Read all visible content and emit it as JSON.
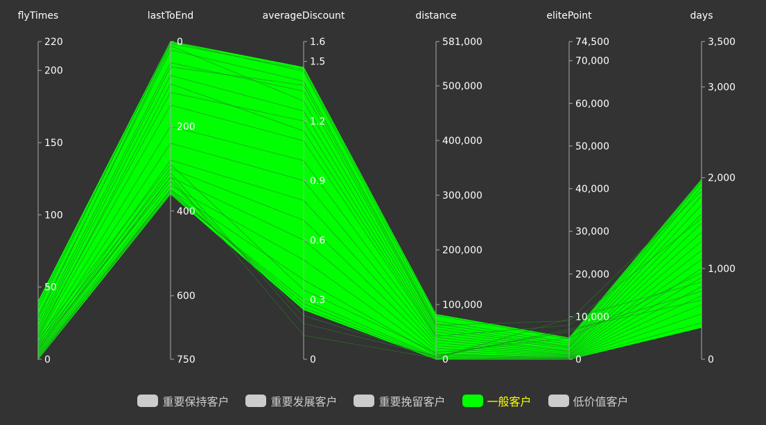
{
  "chart_data": {
    "type": "parallel",
    "dimensions": [
      {
        "name": "flyTimes",
        "min": 0,
        "max": 220,
        "ticks": [
          0,
          50,
          100,
          150,
          200,
          220
        ],
        "tick_labels": [
          "0",
          "50",
          "100",
          "150",
          "200",
          "220"
        ],
        "inverse": false
      },
      {
        "name": "lastToEnd",
        "min": 0,
        "max": 750,
        "ticks": [
          0,
          200,
          400,
          600,
          750
        ],
        "tick_labels": [
          "0",
          "200",
          "400",
          "600",
          "750"
        ],
        "inverse": true
      },
      {
        "name": "averageDiscount",
        "min": 0,
        "max": 1.6,
        "ticks": [
          0,
          0.3,
          0.6,
          0.9,
          1.2,
          1.5,
          1.6
        ],
        "tick_labels": [
          "0",
          "0.3",
          "0.6",
          "0.9",
          "1.2",
          "1.5",
          "1.6"
        ],
        "inverse": false
      },
      {
        "name": "distance",
        "min": 0,
        "max": 581000,
        "ticks": [
          0,
          100000,
          200000,
          300000,
          400000,
          500000,
          581000
        ],
        "tick_labels": [
          "0",
          "100,000",
          "200,000",
          "300,000",
          "400,000",
          "500,000",
          "581,000"
        ],
        "inverse": false
      },
      {
        "name": "elitePoint",
        "min": 0,
        "max": 74500,
        "ticks": [
          0,
          10000,
          20000,
          30000,
          40000,
          50000,
          60000,
          70000,
          74500
        ],
        "tick_labels": [
          "0",
          "10,000",
          "20,000",
          "30,000",
          "40,000",
          "50,000",
          "60,000",
          "70,000",
          "74,500"
        ],
        "inverse": false
      },
      {
        "name": "days",
        "min": 0,
        "max": 3500,
        "ticks": [
          0,
          1000,
          2000,
          3000,
          3500
        ],
        "tick_labels": [
          "0",
          "1,000",
          "2,000",
          "3,000",
          "3,500"
        ],
        "inverse": false
      }
    ],
    "visible_series": "一般客户",
    "series_envelope": {
      "upper": [
        40,
        0,
        1.47,
        82000,
        5000,
        1980
      ],
      "lower": [
        0,
        360,
        0.25,
        0,
        0,
        350
      ]
    },
    "series_lines": [
      [
        35,
        0,
        1.45,
        70000,
        4000,
        1950
      ],
      [
        30,
        20,
        1.4,
        65000,
        3500,
        1900
      ],
      [
        25,
        50,
        1.35,
        60000,
        3000,
        1800
      ],
      [
        28,
        10,
        1.3,
        55000,
        2800,
        1700
      ],
      [
        20,
        80,
        1.25,
        50000,
        2500,
        1600
      ],
      [
        18,
        120,
        1.2,
        45000,
        2000,
        1500
      ],
      [
        15,
        150,
        1.1,
        40000,
        1800,
        1400
      ],
      [
        12,
        200,
        1.0,
        35000,
        1500,
        1300
      ],
      [
        10,
        240,
        0.9,
        30000,
        1200,
        1200
      ],
      [
        8,
        280,
        0.8,
        25000,
        1000,
        1100
      ],
      [
        6,
        300,
        0.7,
        20000,
        800,
        1000
      ],
      [
        5,
        320,
        0.6,
        15000,
        600,
        900
      ],
      [
        4,
        340,
        0.5,
        10000,
        400,
        800
      ],
      [
        3,
        350,
        0.4,
        8000,
        300,
        700
      ],
      [
        2,
        360,
        0.3,
        5000,
        200,
        600
      ],
      [
        1,
        355,
        0.28,
        3000,
        100,
        500
      ],
      [
        0,
        350,
        0.26,
        1000,
        50,
        400
      ],
      [
        38,
        5,
        1.46,
        80000,
        4800,
        1970
      ],
      [
        22,
        60,
        1.38,
        62000,
        9000,
        1850
      ],
      [
        16,
        100,
        1.15,
        42000,
        8000,
        1550
      ],
      [
        9,
        330,
        0.22,
        4000,
        7000,
        650
      ],
      [
        11,
        310,
        0.18,
        6000,
        6500,
        750
      ],
      [
        7,
        320,
        0.12,
        2000,
        9500,
        850
      ],
      [
        14,
        290,
        0.35,
        12000,
        5000,
        950
      ]
    ],
    "series_color": "#00ff00",
    "line_color": "#2a7a2a",
    "legend": [
      {
        "label": "重要保持客户",
        "color": "#cccccc",
        "active": false
      },
      {
        "label": "重要发展客户",
        "color": "#cccccc",
        "active": false
      },
      {
        "label": "重要挽留客户",
        "color": "#cccccc",
        "active": false
      },
      {
        "label": "一般客户",
        "color": "#00ff00",
        "active": true,
        "text_color": "#ffff00"
      },
      {
        "label": "低价值客户",
        "color": "#cccccc",
        "active": false
      }
    ],
    "legend_position": "bottom-center",
    "background": "#333333",
    "axis_color": "#aaaaaa",
    "text_color": "#ffffff"
  }
}
